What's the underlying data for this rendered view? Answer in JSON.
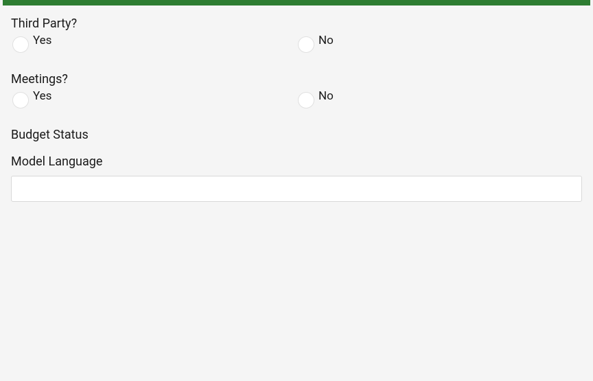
{
  "form": {
    "thirdParty": {
      "label": "Third Party?",
      "yes": "Yes",
      "no": "No"
    },
    "meetings": {
      "label": "Meetings?",
      "yes": "Yes",
      "no": "No"
    },
    "budgetStatus": {
      "label": "Budget Status"
    },
    "modelLanguage": {
      "label": "Model Language",
      "value": ""
    }
  },
  "colors": {
    "accent": "#2e7d32"
  }
}
